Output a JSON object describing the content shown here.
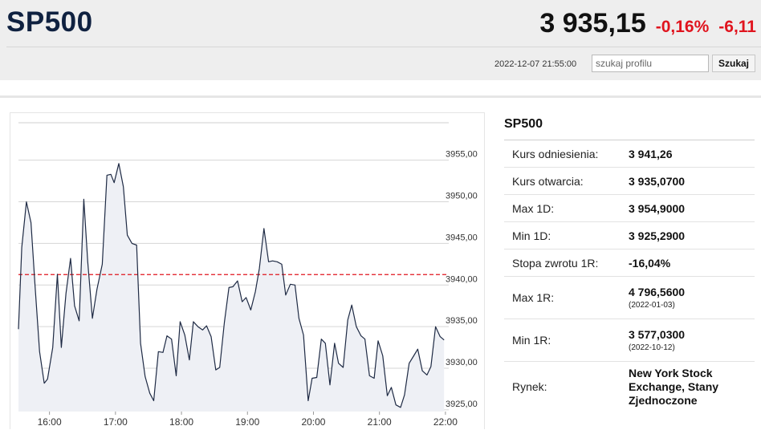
{
  "header": {
    "symbol": "SP500",
    "price": "3 935,15",
    "change_pct": "-0,16%",
    "change_abs": "-6,11",
    "timestamp": "2022-12-07 21:55:00",
    "search_placeholder": "szukaj profilu",
    "search_button": "Szukaj",
    "change_color": "#e0141e"
  },
  "panel": {
    "title": "SP500",
    "rows": [
      {
        "label": "Kurs odniesienia:",
        "value": "3 941,26"
      },
      {
        "label": "Kurs otwarcia:",
        "value": "3 935,0700"
      },
      {
        "label": "Max 1D:",
        "value": "3 954,9000"
      },
      {
        "label": "Min 1D:",
        "value": "3 925,2900"
      },
      {
        "label": "Stopa zwrotu 1R:",
        "value": "-16,04%"
      },
      {
        "label": "Max 1R:",
        "value": "4 796,5600",
        "sub": "(2022-01-03)"
      },
      {
        "label": "Min 1R:",
        "value": "3 577,0300",
        "sub": "(2022-10-12)"
      },
      {
        "label": "Rynek:",
        "value": "New York Stock Exchange, Stany Zjednoczone"
      }
    ]
  },
  "chart_data": {
    "type": "area",
    "line_color": "#1e2a44",
    "fill_color": "#eef0f5",
    "reference_line": {
      "value": 3941.26,
      "color": "#e0141e",
      "style": "dashed"
    },
    "ylim": [
      3924.8,
      3959.5
    ],
    "y_ticks": [
      3925,
      3930,
      3935,
      3940,
      3945,
      3950,
      3955
    ],
    "y_tick_labels": [
      "3925,00",
      "3930,00",
      "3935,00",
      "3940,00",
      "3945,00",
      "3950,00",
      "3955,00"
    ],
    "x_ticks": [
      16,
      17,
      18,
      19,
      20,
      21,
      22
    ],
    "x_tick_labels": [
      "16:00",
      "17:00",
      "18:00",
      "19:00",
      "20:00",
      "21:00",
      "22:00"
    ],
    "x_range": [
      15.53,
      22.05
    ],
    "points": [
      [
        15.53,
        3934.7
      ],
      [
        15.58,
        3944.5
      ],
      [
        15.65,
        3950.0
      ],
      [
        15.72,
        3947.5
      ],
      [
        15.78,
        3940.0
      ],
      [
        15.85,
        3932.0
      ],
      [
        15.92,
        3928.2
      ],
      [
        15.97,
        3928.7
      ],
      [
        16.05,
        3932.5
      ],
      [
        16.12,
        3941.3
      ],
      [
        16.18,
        3932.5
      ],
      [
        16.25,
        3939.0
      ],
      [
        16.32,
        3943.2
      ],
      [
        16.38,
        3937.5
      ],
      [
        16.45,
        3935.7
      ],
      [
        16.52,
        3950.3
      ],
      [
        16.58,
        3942.8
      ],
      [
        16.65,
        3936.0
      ],
      [
        16.72,
        3939.5
      ],
      [
        16.8,
        3942.5
      ],
      [
        16.87,
        3953.2
      ],
      [
        16.93,
        3953.3
      ],
      [
        16.98,
        3952.3
      ],
      [
        17.05,
        3954.6
      ],
      [
        17.12,
        3951.8
      ],
      [
        17.18,
        3946.0
      ],
      [
        17.25,
        3945.0
      ],
      [
        17.32,
        3944.8
      ],
      [
        17.38,
        3933.0
      ],
      [
        17.45,
        3929.0
      ],
      [
        17.52,
        3927.0
      ],
      [
        17.58,
        3926.1
      ],
      [
        17.65,
        3932.0
      ],
      [
        17.72,
        3931.9
      ],
      [
        17.78,
        3933.9
      ],
      [
        17.85,
        3933.5
      ],
      [
        17.92,
        3929.1
      ],
      [
        17.98,
        3935.6
      ],
      [
        18.05,
        3934.0
      ],
      [
        18.12,
        3931.0
      ],
      [
        18.18,
        3935.6
      ],
      [
        18.25,
        3935.0
      ],
      [
        18.32,
        3934.6
      ],
      [
        18.38,
        3935.1
      ],
      [
        18.45,
        3933.8
      ],
      [
        18.52,
        3929.8
      ],
      [
        18.58,
        3930.1
      ],
      [
        18.65,
        3935.5
      ],
      [
        18.72,
        3939.7
      ],
      [
        18.78,
        3939.8
      ],
      [
        18.85,
        3940.5
      ],
      [
        18.92,
        3938.0
      ],
      [
        18.98,
        3938.5
      ],
      [
        19.05,
        3937.0
      ],
      [
        19.12,
        3939.2
      ],
      [
        19.18,
        3942.0
      ],
      [
        19.25,
        3946.8
      ],
      [
        19.32,
        3942.8
      ],
      [
        19.38,
        3942.9
      ],
      [
        19.45,
        3942.8
      ],
      [
        19.52,
        3942.5
      ],
      [
        19.58,
        3938.8
      ],
      [
        19.65,
        3940.1
      ],
      [
        19.72,
        3940.0
      ],
      [
        19.78,
        3936.0
      ],
      [
        19.85,
        3934.0
      ],
      [
        19.92,
        3926.1
      ],
      [
        19.98,
        3928.8
      ],
      [
        20.05,
        3928.9
      ],
      [
        20.12,
        3933.5
      ],
      [
        20.18,
        3933.0
      ],
      [
        20.25,
        3928.0
      ],
      [
        20.32,
        3933.0
      ],
      [
        20.38,
        3930.6
      ],
      [
        20.45,
        3930.1
      ],
      [
        20.52,
        3935.8
      ],
      [
        20.58,
        3937.6
      ],
      [
        20.65,
        3935.0
      ],
      [
        20.72,
        3933.9
      ],
      [
        20.78,
        3933.5
      ],
      [
        20.85,
        3929.1
      ],
      [
        20.92,
        3928.8
      ],
      [
        20.98,
        3933.3
      ],
      [
        21.05,
        3931.5
      ],
      [
        21.12,
        3926.7
      ],
      [
        21.18,
        3927.7
      ],
      [
        21.25,
        3925.6
      ],
      [
        21.32,
        3925.3
      ],
      [
        21.38,
        3926.8
      ],
      [
        21.45,
        3930.6
      ],
      [
        21.52,
        3931.5
      ],
      [
        21.58,
        3932.3
      ],
      [
        21.65,
        3929.7
      ],
      [
        21.72,
        3929.2
      ],
      [
        21.78,
        3930.2
      ],
      [
        21.85,
        3935.0
      ],
      [
        21.92,
        3933.8
      ],
      [
        21.98,
        3933.4
      ]
    ]
  }
}
